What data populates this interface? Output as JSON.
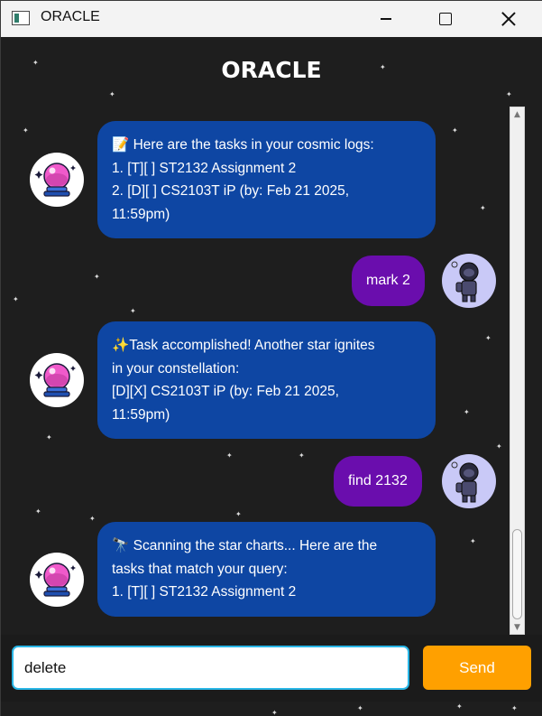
{
  "window": {
    "title": "ORACLE"
  },
  "header": {
    "title": "ORACLE"
  },
  "messages": [
    {
      "sender": "bot",
      "lines": [
        "📝 Here are the tasks in your cosmic logs:",
        "1. [T][ ] ST2132 Assignment 2",
        "2. [D][ ] CS2103T iP (by: Feb 21 2025,",
        "11:59pm)"
      ]
    },
    {
      "sender": "user",
      "text": "mark 2"
    },
    {
      "sender": "bot",
      "lines": [
        "✨Task accomplished! Another star ignites",
        "in your constellation:",
        "[D][X] CS2103T iP (by: Feb 21 2025,",
        "11:59pm)"
      ]
    },
    {
      "sender": "user",
      "text": "find 2132"
    },
    {
      "sender": "bot",
      "lines": [
        "🔭 Scanning the star charts... Here are the",
        "tasks that match your query:",
        "1. [T][ ] ST2132 Assignment 2"
      ]
    }
  ],
  "input": {
    "value": "delete "
  },
  "send": {
    "label": "Send"
  },
  "icons": {
    "bot_avatar": "crystal-ball-icon",
    "user_avatar": "astronaut-icon",
    "app_icon": "app-window-icon"
  },
  "colors": {
    "bot_bubble": "#0e46a3",
    "user_bubble": "#6a0dad",
    "send_button": "#ffa000",
    "input_focus_border": "#29b6e6",
    "background": "#1e1e1e"
  }
}
